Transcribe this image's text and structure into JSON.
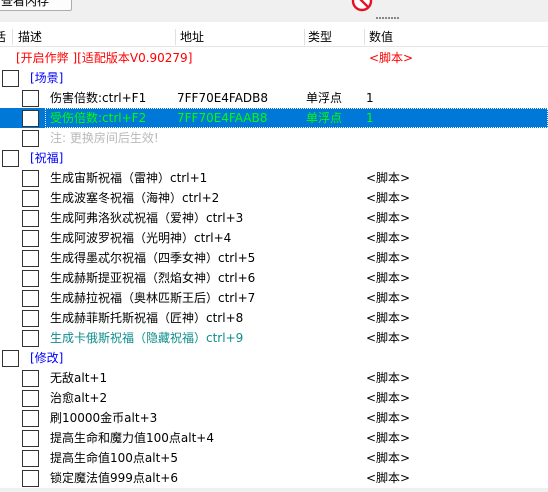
{
  "toolbar": {
    "view_memory_label": "查看内存",
    "no_icon": "prohibited-icon"
  },
  "colors": {
    "script_red": "#ff0000",
    "group_blue": "#0000ff",
    "hidden_teal": "#0e8c8c",
    "note_gray": "#b9b9b9",
    "selection_blue": "#0078d7",
    "selection_green_text": "#00ff00"
  },
  "header": {
    "active_label": "活",
    "description_label": "描述",
    "address_label": "地址",
    "type_label": "类型",
    "value_label": "数值"
  },
  "rows": [
    {
      "kind": "script",
      "description": "[开启作弊 ][适配版本V0.90279]",
      "address": "",
      "type": "",
      "value": "<脚本>"
    },
    {
      "kind": "group",
      "description": "[场景]",
      "address": "",
      "type": "",
      "value": ""
    },
    {
      "kind": "entry",
      "description": "伤害倍数:ctrl+F1",
      "address": "7FF70E4FADB8",
      "type": "单浮点",
      "value": "1"
    },
    {
      "kind": "entry-selected",
      "description": "受伤倍数:ctrl+F2",
      "address": "7FF70E4FAAB8",
      "type": "单浮点",
      "value": "1"
    },
    {
      "kind": "note",
      "description": "注: 更换房间后生效!",
      "address": "",
      "type": "",
      "value": ""
    },
    {
      "kind": "group",
      "description": "[祝福]",
      "address": "",
      "type": "",
      "value": ""
    },
    {
      "kind": "sub-script",
      "description": "生成宙斯祝福（雷神）ctrl+1",
      "address": "",
      "type": "",
      "value": "<脚本>"
    },
    {
      "kind": "sub-script",
      "description": "生成波塞冬祝福（海神）ctrl+2",
      "address": "",
      "type": "",
      "value": "<脚本>"
    },
    {
      "kind": "sub-script",
      "description": "生成阿弗洛狄忒祝福（爱神）ctrl+3",
      "address": "",
      "type": "",
      "value": "<脚本>"
    },
    {
      "kind": "sub-script",
      "description": "生成阿波罗祝福（光明神）ctrl+4",
      "address": "",
      "type": "",
      "value": "<脚本>"
    },
    {
      "kind": "sub-script",
      "description": "生成得墨忒尔祝福（四季女神）ctrl+5",
      "address": "",
      "type": "",
      "value": "<脚本>"
    },
    {
      "kind": "sub-script",
      "description": "生成赫斯提亚祝福（烈焰女神）ctrl+6",
      "address": "",
      "type": "",
      "value": "<脚本>"
    },
    {
      "kind": "sub-script",
      "description": "生成赫拉祝福（奥林匹斯王后）ctrl+7",
      "address": "",
      "type": "",
      "value": "<脚本>"
    },
    {
      "kind": "sub-script",
      "description": "生成赫菲斯托斯祝福（匠神）ctrl+8",
      "address": "",
      "type": "",
      "value": "<脚本>"
    },
    {
      "kind": "hidden",
      "description": "生成卡俄斯祝福（隐藏祝福）ctrl+9",
      "address": "",
      "type": "",
      "value": "<脚本>"
    },
    {
      "kind": "group",
      "description": "[修改]",
      "address": "",
      "type": "",
      "value": ""
    },
    {
      "kind": "sub-script",
      "description": "无敌alt+1",
      "address": "",
      "type": "",
      "value": "<脚本>"
    },
    {
      "kind": "sub-script",
      "description": "治愈alt+2",
      "address": "",
      "type": "",
      "value": "<脚本>"
    },
    {
      "kind": "sub-script",
      "description": "刷10000金币alt+3",
      "address": "",
      "type": "",
      "value": "<脚本>"
    },
    {
      "kind": "sub-script",
      "description": "提高生命和魔力值100点alt+4",
      "address": "",
      "type": "",
      "value": "<脚本>"
    },
    {
      "kind": "sub-script",
      "description": "提高生命值100点alt+5",
      "address": "",
      "type": "",
      "value": "<脚本>"
    },
    {
      "kind": "sub-script",
      "description": "锁定魔法值999点alt+6",
      "address": "",
      "type": "",
      "value": "<脚本>"
    }
  ]
}
